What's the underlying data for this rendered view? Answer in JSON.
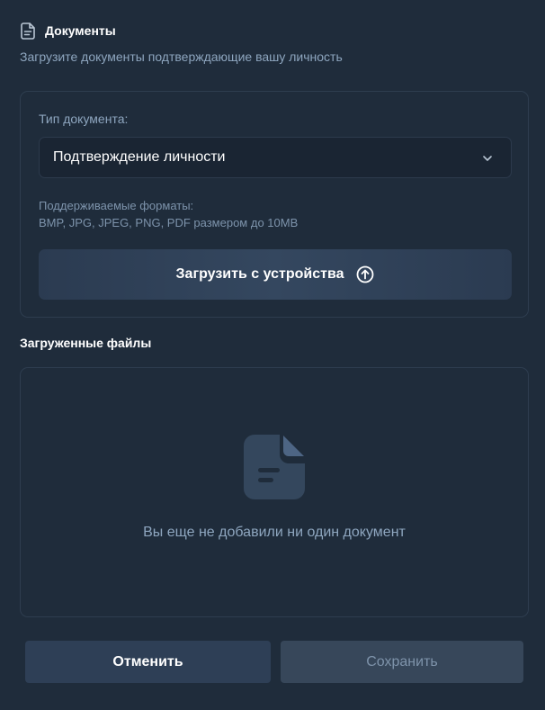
{
  "header": {
    "icon": "document-icon",
    "title": "Документы",
    "subtitle": "Загрузите документы подтверждающие вашу личность"
  },
  "upload_card": {
    "doc_type_label": "Тип документа:",
    "doc_type_value": "Подтверждение личности",
    "formats_label": "Поддерживаемые форматы:",
    "formats_list": "BMP, JPG, JPEG, PNG, PDF размером до 10MB",
    "upload_button_label": "Загрузить с устройства",
    "upload_icon": "arrow-up-circle-icon"
  },
  "uploaded_files": {
    "heading": "Загруженные файлы",
    "empty_icon": "empty-document-icon",
    "empty_text": "Вы еще не добавили ни один документ"
  },
  "actions": {
    "cancel_label": "Отменить",
    "save_label": "Сохранить"
  },
  "colors": {
    "background": "#1f2c3b",
    "card_border": "#2e3d4f",
    "muted_text": "#8ea6bf",
    "primary_button": "#2e3f56",
    "disabled_button": "#37475a"
  }
}
